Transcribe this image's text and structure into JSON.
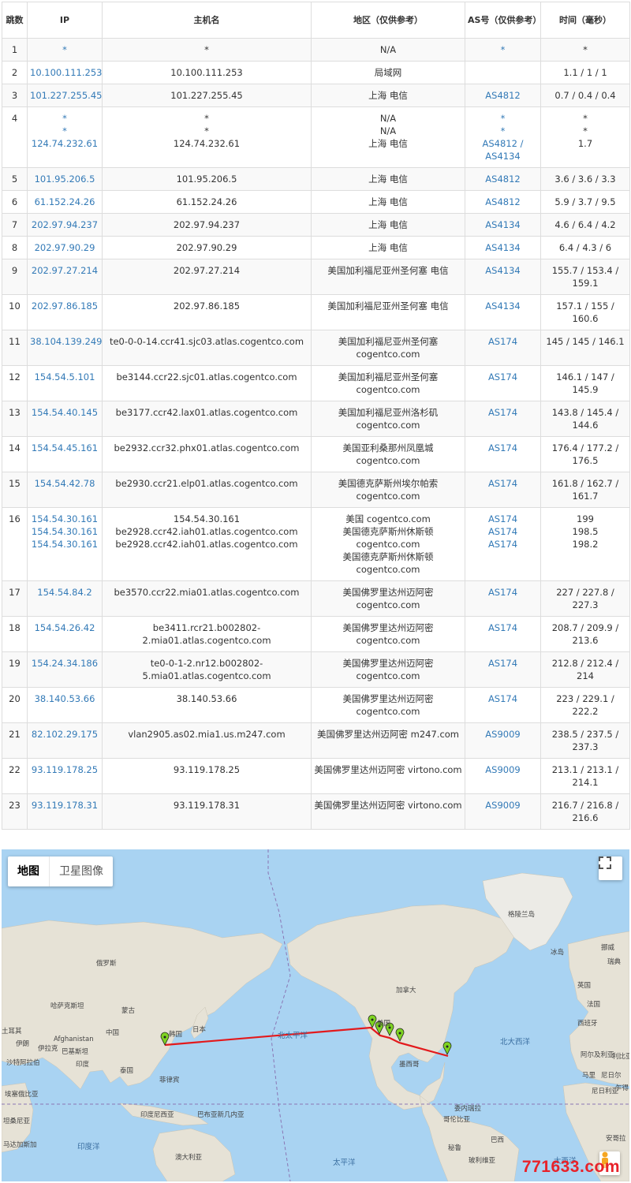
{
  "table": {
    "headers": {
      "hop": "跳数",
      "ip": "IP",
      "hostname": "主机名",
      "location": "地区（仅供参考）",
      "asn": "AS号（仅供参考）",
      "time": "时间（毫秒）"
    },
    "rows": [
      {
        "hop": "1",
        "ip": [
          "*"
        ],
        "host": [
          "*"
        ],
        "loc": [
          "N/A"
        ],
        "asn": [
          "*"
        ],
        "time": [
          "*"
        ]
      },
      {
        "hop": "2",
        "ip": [
          "10.100.111.253"
        ],
        "host": [
          "10.100.111.253"
        ],
        "loc": [
          "局域网"
        ],
        "asn": [
          ""
        ],
        "time": [
          "1.1 / 1 / 1"
        ]
      },
      {
        "hop": "3",
        "ip": [
          "101.227.255.45"
        ],
        "host": [
          "101.227.255.45"
        ],
        "loc": [
          "上海 电信"
        ],
        "asn": [
          "AS4812"
        ],
        "time": [
          "0.7 / 0.4 / 0.4"
        ]
      },
      {
        "hop": "4",
        "ip": [
          "*",
          "*",
          "124.74.232.61"
        ],
        "host": [
          "*",
          "*",
          "124.74.232.61"
        ],
        "loc": [
          "N/A",
          "N/A",
          "上海 电信"
        ],
        "asn": [
          "*",
          "*",
          "AS4812 /",
          "AS4134"
        ],
        "time": [
          "*",
          "*",
          "1.7"
        ]
      },
      {
        "hop": "5",
        "ip": [
          "101.95.206.5"
        ],
        "host": [
          "101.95.206.5"
        ],
        "loc": [
          "上海 电信"
        ],
        "asn": [
          "AS4812"
        ],
        "time": [
          "3.6 / 3.6 / 3.3"
        ]
      },
      {
        "hop": "6",
        "ip": [
          "61.152.24.26"
        ],
        "host": [
          "61.152.24.26"
        ],
        "loc": [
          "上海 电信"
        ],
        "asn": [
          "AS4812"
        ],
        "time": [
          "5.9 / 3.7 / 9.5"
        ]
      },
      {
        "hop": "7",
        "ip": [
          "202.97.94.237"
        ],
        "host": [
          "202.97.94.237"
        ],
        "loc": [
          "上海 电信"
        ],
        "asn": [
          "AS4134"
        ],
        "time": [
          "4.6 / 6.4 / 4.2"
        ]
      },
      {
        "hop": "8",
        "ip": [
          "202.97.90.29"
        ],
        "host": [
          "202.97.90.29"
        ],
        "loc": [
          "上海 电信"
        ],
        "asn": [
          "AS4134"
        ],
        "time": [
          "6.4 / 4.3 / 6"
        ]
      },
      {
        "hop": "9",
        "ip": [
          "202.97.27.214"
        ],
        "host": [
          "202.97.27.214"
        ],
        "loc": [
          "美国加利福尼亚州圣何塞 电信"
        ],
        "asn": [
          "AS4134"
        ],
        "time": [
          "155.7 / 153.4 /",
          "159.1"
        ]
      },
      {
        "hop": "10",
        "ip": [
          "202.97.86.185"
        ],
        "host": [
          "202.97.86.185"
        ],
        "loc": [
          "美国加利福尼亚州圣何塞 电信"
        ],
        "asn": [
          "AS4134"
        ],
        "time": [
          "157.1 / 155 /",
          "160.6"
        ]
      },
      {
        "hop": "11",
        "ip": [
          "38.104.139.249"
        ],
        "host": [
          "te0-0-0-14.ccr41.sjc03.atlas.cogentco.com"
        ],
        "loc": [
          "美国加利福尼亚州圣何塞",
          "cogentco.com"
        ],
        "asn": [
          "AS174"
        ],
        "time": [
          "145 / 145 / 146.1"
        ]
      },
      {
        "hop": "12",
        "ip": [
          "154.54.5.101"
        ],
        "host": [
          "be3144.ccr22.sjc01.atlas.cogentco.com"
        ],
        "loc": [
          "美国加利福尼亚州圣何塞",
          "cogentco.com"
        ],
        "asn": [
          "AS174"
        ],
        "time": [
          "146.1 / 147 /",
          "145.9"
        ]
      },
      {
        "hop": "13",
        "ip": [
          "154.54.40.145"
        ],
        "host": [
          "be3177.ccr42.lax01.atlas.cogentco.com"
        ],
        "loc": [
          "美国加利福尼亚州洛杉矶",
          "cogentco.com"
        ],
        "asn": [
          "AS174"
        ],
        "time": [
          "143.8 / 145.4 /",
          "144.6"
        ]
      },
      {
        "hop": "14",
        "ip": [
          "154.54.45.161"
        ],
        "host": [
          "be2932.ccr32.phx01.atlas.cogentco.com"
        ],
        "loc": [
          "美国亚利桑那州凤凰城",
          "cogentco.com"
        ],
        "asn": [
          "AS174"
        ],
        "time": [
          "176.4 / 177.2 /",
          "176.5"
        ]
      },
      {
        "hop": "15",
        "ip": [
          "154.54.42.78"
        ],
        "host": [
          "be2930.ccr21.elp01.atlas.cogentco.com"
        ],
        "loc": [
          "美国德克萨斯州埃尔帕索",
          "cogentco.com"
        ],
        "asn": [
          "AS174"
        ],
        "time": [
          "161.8 / 162.7 /",
          "161.7"
        ]
      },
      {
        "hop": "16",
        "ip": [
          "154.54.30.161",
          "154.54.30.161",
          "154.54.30.161"
        ],
        "host": [
          "154.54.30.161",
          "be2928.ccr42.iah01.atlas.cogentco.com",
          "be2928.ccr42.iah01.atlas.cogentco.com"
        ],
        "loc": [
          "美国 cogentco.com",
          "美国德克萨斯州休斯顿",
          "cogentco.com",
          "美国德克萨斯州休斯顿",
          "cogentco.com"
        ],
        "asn": [
          "AS174",
          "AS174",
          "AS174"
        ],
        "time": [
          "199",
          "198.5",
          "198.2"
        ]
      },
      {
        "hop": "17",
        "ip": [
          "154.54.84.2"
        ],
        "host": [
          "be3570.ccr22.mia01.atlas.cogentco.com"
        ],
        "loc": [
          "美国佛罗里达州迈阿密",
          "cogentco.com"
        ],
        "asn": [
          "AS174"
        ],
        "time": [
          "227 / 227.8 /",
          "227.3"
        ]
      },
      {
        "hop": "18",
        "ip": [
          "154.54.26.42"
        ],
        "host": [
          "be3411.rcr21.b002802-",
          "2.mia01.atlas.cogentco.com"
        ],
        "loc": [
          "美国佛罗里达州迈阿密",
          "cogentco.com"
        ],
        "asn": [
          "AS174"
        ],
        "time": [
          "208.7 / 209.9 /",
          "213.6"
        ]
      },
      {
        "hop": "19",
        "ip": [
          "154.24.34.186"
        ],
        "host": [
          "te0-0-1-2.nr12.b002802-",
          "5.mia01.atlas.cogentco.com"
        ],
        "loc": [
          "美国佛罗里达州迈阿密",
          "cogentco.com"
        ],
        "asn": [
          "AS174"
        ],
        "time": [
          "212.8 / 212.4 /",
          "214"
        ]
      },
      {
        "hop": "20",
        "ip": [
          "38.140.53.66"
        ],
        "host": [
          "38.140.53.66"
        ],
        "loc": [
          "美国佛罗里达州迈阿密",
          "cogentco.com"
        ],
        "asn": [
          "AS174"
        ],
        "time": [
          "223 / 229.1 /",
          "222.2"
        ]
      },
      {
        "hop": "21",
        "ip": [
          "82.102.29.175"
        ],
        "host": [
          "vlan2905.as02.mia1.us.m247.com"
        ],
        "loc": [
          "美国佛罗里达州迈阿密 m247.com"
        ],
        "asn": [
          "AS9009"
        ],
        "time": [
          "238.5 / 237.5 /",
          "237.3"
        ]
      },
      {
        "hop": "22",
        "ip": [
          "93.119.178.25"
        ],
        "host": [
          "93.119.178.25"
        ],
        "loc": [
          "美国佛罗里达州迈阿密 virtono.com"
        ],
        "asn": [
          "AS9009"
        ],
        "time": [
          "213.1 / 213.1 /",
          "214.1"
        ]
      },
      {
        "hop": "23",
        "ip": [
          "93.119.178.31"
        ],
        "host": [
          "93.119.178.31"
        ],
        "loc": [
          "美国佛罗里达州迈阿密 virtono.com"
        ],
        "asn": [
          "AS9009"
        ],
        "time": [
          "216.7 / 216.8 /",
          "216.6"
        ]
      }
    ]
  },
  "map": {
    "type_buttons": [
      "地图",
      "卫星图像"
    ],
    "selected_type": "地图",
    "labels": {
      "greenland": "格陵兰岛",
      "iceland": "冰岛",
      "russia": "俄罗斯",
      "kazakhstan": "哈萨克斯坦",
      "mongolia": "蒙古",
      "china": "中国",
      "korea": "韩国",
      "japan": "日本",
      "afghanistan": "Afghanistan",
      "pakistan": "巴基斯坦",
      "iran": "伊朗",
      "iraq": "伊拉克",
      "turkey": "土耳其",
      "saudi": "沙特阿拉伯",
      "india": "印度",
      "thailand": "泰国",
      "philippines": "菲律宾",
      "indonesia": "印度尼西亚",
      "png": "巴布亚新几内亚",
      "australia": "澳大利亚",
      "ethiopia": "埃塞俄比亚",
      "kenya": "坦桑尼亚",
      "madagascar": "马达加斯加",
      "canada": "加拿大",
      "usa": "美国",
      "mexico": "墨西哥",
      "venezuela": "委内瑞拉",
      "colombia": "哥伦比亚",
      "peru": "秘鲁",
      "brazil": "巴西",
      "bolivia": "玻利维亚",
      "norway": "挪威",
      "sweden": "瑞典",
      "uk": "英国",
      "france": "法国",
      "spain": "西班牙",
      "algeria": "阿尔及利亚",
      "mali": "马里",
      "niger": "尼日尔",
      "nigeria": "尼日利亚",
      "angola": "安哥拉",
      "chad": "乍得",
      "libya": "利比亚"
    },
    "seas": {
      "north_pacific": "北太平洋",
      "north_atlantic": "北大西洋",
      "south_pacific": "太平洋",
      "indian_ocean": "印度洋",
      "south_atlantic": "大西洋"
    }
  },
  "watermark": "771633.com"
}
